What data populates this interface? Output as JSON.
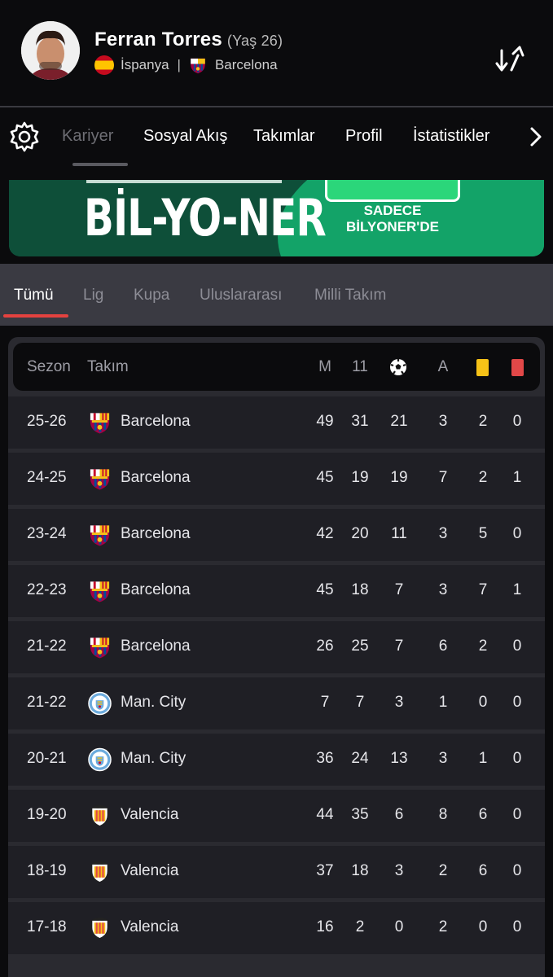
{
  "player": {
    "name": "Ferran Torres",
    "age": "(Yaş 26)",
    "country": "İspanya",
    "separator": "|",
    "club": "Barcelona"
  },
  "nav": {
    "tabs": [
      "Kariyer",
      "Sosyal Akış",
      "Takımlar",
      "Profil",
      "İstatistikler"
    ],
    "active_index": 0
  },
  "ad": {
    "brand": "BİL-YO-NER",
    "tagline_1": "SADECE",
    "tagline_2": "BİLYONER'DE"
  },
  "filters": {
    "tabs": [
      "Tümü",
      "Lig",
      "Kupa",
      "Uluslararası",
      "Milli Takım"
    ],
    "active_index": 0
  },
  "table": {
    "headers": {
      "season": "Sezon",
      "team": "Takım",
      "matches": "M",
      "starts": "11",
      "goals_icon": "soccer-ball-icon",
      "assists": "A",
      "yellow_icon": "yellow-card-icon",
      "red_icon": "red-card-icon"
    },
    "colors": {
      "yellow_card": "#f6c217",
      "red_card": "#e24848",
      "accent": "#e4423f"
    },
    "rows": [
      {
        "season": "25-26",
        "team": "Barcelona",
        "crest": "barcelona-crest",
        "m": "49",
        "starts": "31",
        "goals": "21",
        "a": "3",
        "y": "2",
        "r": "0"
      },
      {
        "season": "24-25",
        "team": "Barcelona",
        "crest": "barcelona-crest",
        "m": "45",
        "starts": "19",
        "goals": "19",
        "a": "7",
        "y": "2",
        "r": "1"
      },
      {
        "season": "23-24",
        "team": "Barcelona",
        "crest": "barcelona-crest",
        "m": "42",
        "starts": "20",
        "goals": "11",
        "a": "3",
        "y": "5",
        "r": "0"
      },
      {
        "season": "22-23",
        "team": "Barcelona",
        "crest": "barcelona-crest",
        "m": "45",
        "starts": "18",
        "goals": "7",
        "a": "3",
        "y": "7",
        "r": "1"
      },
      {
        "season": "21-22",
        "team": "Barcelona",
        "crest": "barcelona-crest",
        "m": "26",
        "starts": "25",
        "goals": "7",
        "a": "6",
        "y": "2",
        "r": "0"
      },
      {
        "season": "21-22",
        "team": "Man. City",
        "crest": "man-city-crest",
        "m": "7",
        "starts": "7",
        "goals": "3",
        "a": "1",
        "y": "0",
        "r": "0"
      },
      {
        "season": "20-21",
        "team": "Man. City",
        "crest": "man-city-crest",
        "m": "36",
        "starts": "24",
        "goals": "13",
        "a": "3",
        "y": "1",
        "r": "0"
      },
      {
        "season": "19-20",
        "team": "Valencia",
        "crest": "valencia-crest",
        "m": "44",
        "starts": "35",
        "goals": "6",
        "a": "8",
        "y": "6",
        "r": "0"
      },
      {
        "season": "18-19",
        "team": "Valencia",
        "crest": "valencia-crest",
        "m": "37",
        "starts": "18",
        "goals": "3",
        "a": "2",
        "y": "6",
        "r": "0"
      },
      {
        "season": "17-18",
        "team": "Valencia",
        "crest": "valencia-crest",
        "m": "16",
        "starts": "2",
        "goals": "0",
        "a": "2",
        "y": "0",
        "r": "0"
      }
    ]
  }
}
